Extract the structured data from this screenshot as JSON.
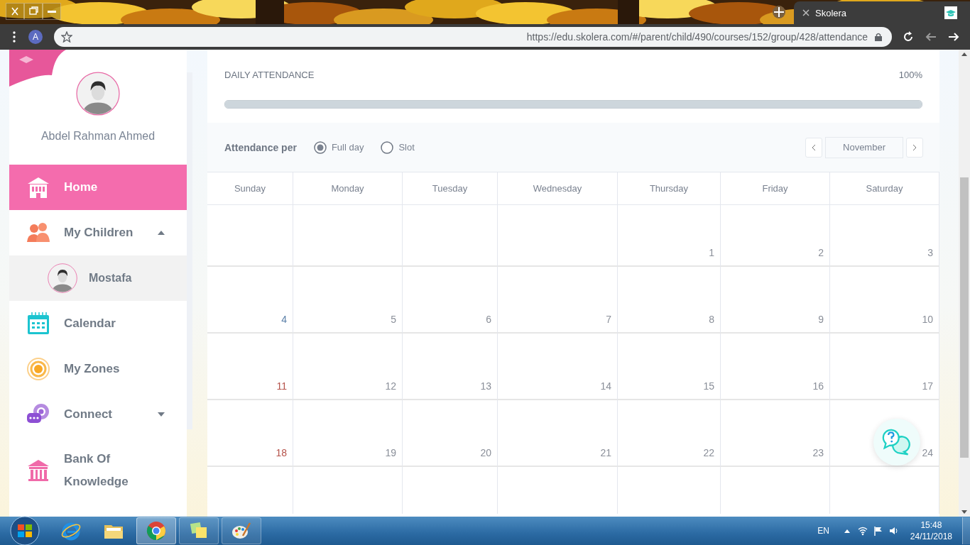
{
  "browser": {
    "tab_title": "Skolera",
    "url": "https://edu.skolera.com/#/parent/child/490/courses/152/group/428/attendance",
    "profile_letter": "A"
  },
  "sidebar": {
    "user_name": "Abdel Rahman Ahmed",
    "items": [
      {
        "kind": "home",
        "label": "Home",
        "selected": true
      },
      {
        "kind": "children",
        "label": "My Children",
        "selected": false,
        "expanded": true,
        "children": [
          {
            "label": "Mostafa"
          }
        ]
      },
      {
        "kind": "calendar",
        "label": "Calendar",
        "selected": false
      },
      {
        "kind": "zones",
        "label": "My Zones",
        "selected": false
      },
      {
        "kind": "connect",
        "label": "Connect",
        "selected": false,
        "expanded": false
      },
      {
        "kind": "bank",
        "label": "Bank Of Knowledge",
        "selected": false
      }
    ]
  },
  "attendance": {
    "title": "DAILY ATTENDANCE",
    "percent": "100%",
    "level": 1,
    "per_label": "Attendance per",
    "options": [
      {
        "label": "Full day",
        "selected": true
      },
      {
        "label": "Slot",
        "selected": false
      }
    ],
    "month": "November"
  },
  "calendar": {
    "weekdays": [
      "Sunday",
      "Monday",
      "Tuesday",
      "Wednesday",
      "Thursday",
      "Friday",
      "Saturday"
    ],
    "weeks": [
      [
        {
          "kind": "empty"
        },
        {
          "kind": "empty"
        },
        {
          "kind": "empty"
        },
        {
          "kind": "empty"
        },
        {
          "kind": "day",
          "day": "1",
          "color": "#8a8f99"
        },
        {
          "kind": "day",
          "day": "2",
          "color": "#8a8f99"
        },
        {
          "kind": "day",
          "day": "3",
          "color": "#8a8f99"
        }
      ],
      [
        {
          "kind": "day",
          "day": "4",
          "color": "#5a7fa8"
        },
        {
          "kind": "day",
          "day": "5",
          "color": "#8a8f99"
        },
        {
          "kind": "day",
          "day": "6",
          "color": "#8a8f99"
        },
        {
          "kind": "day",
          "day": "7",
          "color": "#8a8f99"
        },
        {
          "kind": "day",
          "day": "8",
          "color": "#8a8f99"
        },
        {
          "kind": "day",
          "day": "9",
          "color": "#8a8f99"
        },
        {
          "kind": "day",
          "day": "10",
          "color": "#8a8f99"
        }
      ],
      [
        {
          "kind": "day",
          "day": "11",
          "color": "#b5524a"
        },
        {
          "kind": "day",
          "day": "12",
          "color": "#8a8f99"
        },
        {
          "kind": "day",
          "day": "13",
          "color": "#8a8f99"
        },
        {
          "kind": "day",
          "day": "14",
          "color": "#8a8f99"
        },
        {
          "kind": "day",
          "day": "15",
          "color": "#8a8f99"
        },
        {
          "kind": "day",
          "day": "16",
          "color": "#8a8f99"
        },
        {
          "kind": "day",
          "day": "17",
          "color": "#8a8f99"
        }
      ],
      [
        {
          "kind": "day",
          "day": "18",
          "color": "#b5524a"
        },
        {
          "kind": "day",
          "day": "19",
          "color": "#8a8f99"
        },
        {
          "kind": "day",
          "day": "20",
          "color": "#8a8f99"
        },
        {
          "kind": "day",
          "day": "21",
          "color": "#8a8f99"
        },
        {
          "kind": "day",
          "day": "22",
          "color": "#8a8f99"
        },
        {
          "kind": "day",
          "day": "23",
          "color": "#8a8f99"
        },
        {
          "kind": "day",
          "day": "24",
          "color": "#8a8f99"
        }
      ],
      [
        {
          "kind": "empty"
        },
        {
          "kind": "empty"
        },
        {
          "kind": "empty"
        },
        {
          "kind": "empty"
        },
        {
          "kind": "empty"
        },
        {
          "kind": "empty"
        },
        {
          "kind": "empty"
        }
      ]
    ]
  },
  "taskbar": {
    "language": "EN",
    "time": "15:48",
    "date": "24/11/2018"
  }
}
